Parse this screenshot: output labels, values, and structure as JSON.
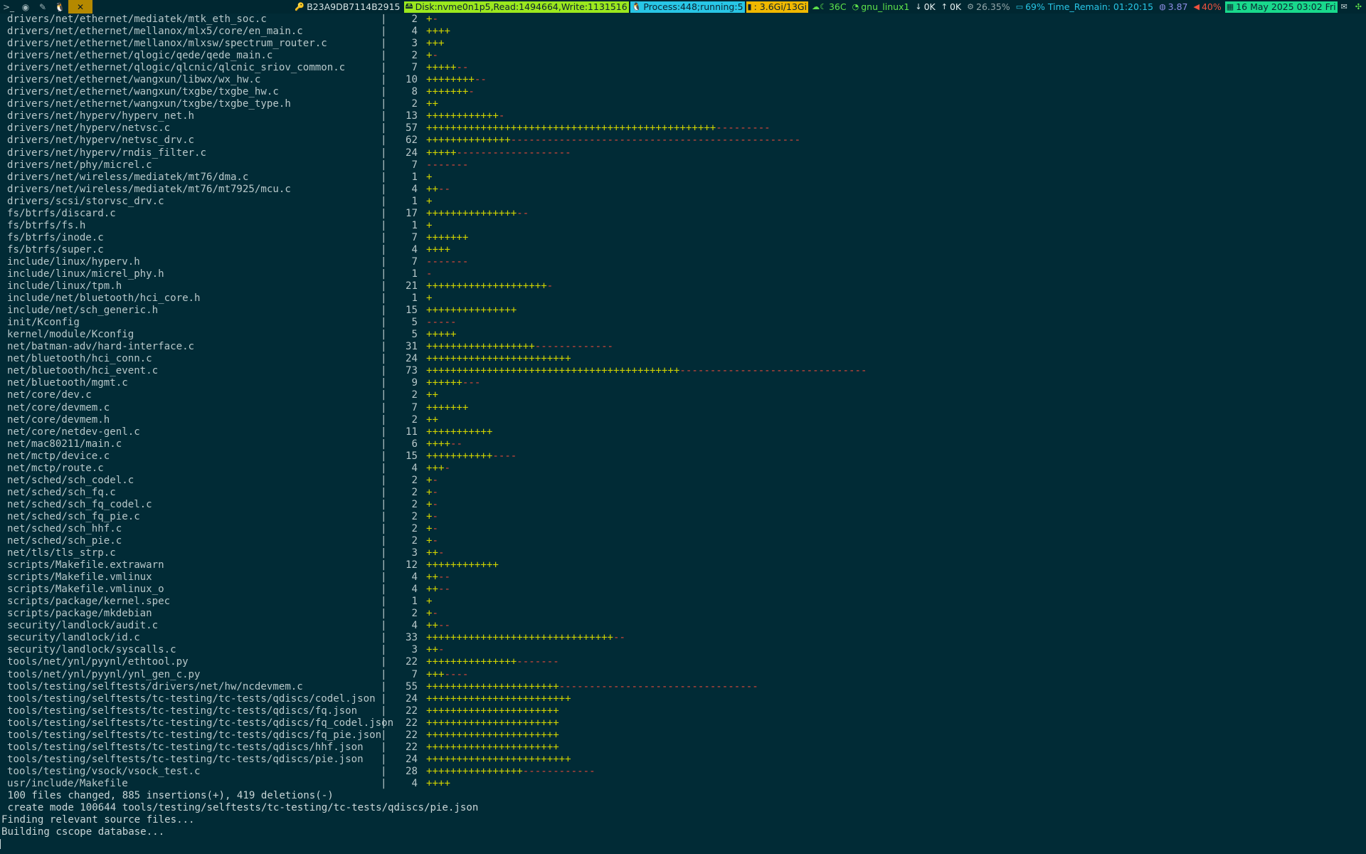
{
  "topbar": {
    "workspaces": [
      {
        "icon": ">_",
        "active": false
      },
      {
        "icon": "◉",
        "active": false
      },
      {
        "icon": "✎",
        "active": false
      },
      {
        "icon": "🐧",
        "active": false
      },
      {
        "icon": "✕",
        "active": true
      }
    ],
    "host": "B23A9DB7114B2915",
    "disk": "Disk:nvme0n1p5,Read:1494664,Write:1131516",
    "process": "Process:448;running:5",
    "memory": " : 3.6Gi/13Gi",
    "temp": "36C",
    "wifi": "gnu_linux1",
    "net_down": "0K",
    "net_up": "0K",
    "cpu": "26.35%",
    "battery": "69% Time_Remain: 01:20:15",
    "load": "3.87",
    "volume": "40%",
    "date": "16 May 2025 03:02 Fri",
    "colors": {
      "accent": "#b58900",
      "disk": "#9be81e",
      "process": "#28c6e6",
      "memory": "#f0b800",
      "date": "#19d98c",
      "plus": "#d1d300",
      "minus": "#e0483a",
      "background": "#012b36"
    }
  },
  "diffstat": [
    {
      "path": "drivers/net/ethernet/mediatek/mtk_eth_soc.c",
      "n": "2",
      "plus": "+",
      "minus": "-"
    },
    {
      "path": "drivers/net/ethernet/mellanox/mlx5/core/en_main.c",
      "n": "4",
      "plus": "++++",
      "minus": ""
    },
    {
      "path": "drivers/net/ethernet/mellanox/mlxsw/spectrum_router.c",
      "n": "3",
      "plus": "+++",
      "minus": ""
    },
    {
      "path": "drivers/net/ethernet/qlogic/qede/qede_main.c",
      "n": "2",
      "plus": "+",
      "minus": "-"
    },
    {
      "path": "drivers/net/ethernet/qlogic/qlcnic/qlcnic_sriov_common.c",
      "n": "7",
      "plus": "+++++",
      "minus": "--"
    },
    {
      "path": "drivers/net/ethernet/wangxun/libwx/wx_hw.c",
      "n": "10",
      "plus": "++++++++",
      "minus": "--"
    },
    {
      "path": "drivers/net/ethernet/wangxun/txgbe/txgbe_hw.c",
      "n": "8",
      "plus": "+++++++",
      "minus": "-"
    },
    {
      "path": "drivers/net/ethernet/wangxun/txgbe/txgbe_type.h",
      "n": "2",
      "plus": "++",
      "minus": ""
    },
    {
      "path": "drivers/net/hyperv/hyperv_net.h",
      "n": "13",
      "plus": "++++++++++++",
      "minus": "-"
    },
    {
      "path": "drivers/net/hyperv/netvsc.c",
      "n": "57",
      "plus": "++++++++++++++++++++++++++++++++++++++++++++++++",
      "minus": "---------"
    },
    {
      "path": "drivers/net/hyperv/netvsc_drv.c",
      "n": "62",
      "plus": "++++++++++++++",
      "minus": "------------------------------------------------"
    },
    {
      "path": "drivers/net/hyperv/rndis_filter.c",
      "n": "24",
      "plus": "+++++",
      "minus": "-------------------"
    },
    {
      "path": "drivers/net/phy/micrel.c",
      "n": "7",
      "plus": "",
      "minus": "-------"
    },
    {
      "path": "drivers/net/wireless/mediatek/mt76/dma.c",
      "n": "1",
      "plus": "+",
      "minus": ""
    },
    {
      "path": "drivers/net/wireless/mediatek/mt76/mt7925/mcu.c",
      "n": "4",
      "plus": "++",
      "minus": "--"
    },
    {
      "path": "drivers/scsi/storvsc_drv.c",
      "n": "1",
      "plus": "+",
      "minus": ""
    },
    {
      "path": "fs/btrfs/discard.c",
      "n": "17",
      "plus": "+++++++++++++++",
      "minus": "--"
    },
    {
      "path": "fs/btrfs/fs.h",
      "n": "1",
      "plus": "+",
      "minus": ""
    },
    {
      "path": "fs/btrfs/inode.c",
      "n": "7",
      "plus": "+++++++",
      "minus": ""
    },
    {
      "path": "fs/btrfs/super.c",
      "n": "4",
      "plus": "++++",
      "minus": ""
    },
    {
      "path": "include/linux/hyperv.h",
      "n": "7",
      "plus": "",
      "minus": "-------"
    },
    {
      "path": "include/linux/micrel_phy.h",
      "n": "1",
      "plus": "",
      "minus": "-"
    },
    {
      "path": "include/linux/tpm.h",
      "n": "21",
      "plus": "++++++++++++++++++++",
      "minus": "-"
    },
    {
      "path": "include/net/bluetooth/hci_core.h",
      "n": "1",
      "plus": "+",
      "minus": ""
    },
    {
      "path": "include/net/sch_generic.h",
      "n": "15",
      "plus": "+++++++++++++++",
      "minus": ""
    },
    {
      "path": "init/Kconfig",
      "n": "5",
      "plus": "",
      "minus": "-----"
    },
    {
      "path": "kernel/module/Kconfig",
      "n": "5",
      "plus": "+++++",
      "minus": ""
    },
    {
      "path": "net/batman-adv/hard-interface.c",
      "n": "31",
      "plus": "++++++++++++++++++",
      "minus": "-------------"
    },
    {
      "path": "net/bluetooth/hci_conn.c",
      "n": "24",
      "plus": "++++++++++++++++++++++++",
      "minus": ""
    },
    {
      "path": "net/bluetooth/hci_event.c",
      "n": "73",
      "plus": "++++++++++++++++++++++++++++++++++++++++++",
      "minus": "-------------------------------"
    },
    {
      "path": "net/bluetooth/mgmt.c",
      "n": "9",
      "plus": "++++++",
      "minus": "---"
    },
    {
      "path": "net/core/dev.c",
      "n": "2",
      "plus": "++",
      "minus": ""
    },
    {
      "path": "net/core/devmem.c",
      "n": "7",
      "plus": "+++++++",
      "minus": ""
    },
    {
      "path": "net/core/devmem.h",
      "n": "2",
      "plus": "++",
      "minus": ""
    },
    {
      "path": "net/core/netdev-genl.c",
      "n": "11",
      "plus": "+++++++++++",
      "minus": ""
    },
    {
      "path": "net/mac80211/main.c",
      "n": "6",
      "plus": "++++",
      "minus": "--"
    },
    {
      "path": "net/mctp/device.c",
      "n": "15",
      "plus": "+++++++++++",
      "minus": "----"
    },
    {
      "path": "net/mctp/route.c",
      "n": "4",
      "plus": "+++",
      "minus": "-"
    },
    {
      "path": "net/sched/sch_codel.c",
      "n": "2",
      "plus": "+",
      "minus": "-"
    },
    {
      "path": "net/sched/sch_fq.c",
      "n": "2",
      "plus": "+",
      "minus": "-"
    },
    {
      "path": "net/sched/sch_fq_codel.c",
      "n": "2",
      "plus": "+",
      "minus": "-"
    },
    {
      "path": "net/sched/sch_fq_pie.c",
      "n": "2",
      "plus": "+",
      "minus": "-"
    },
    {
      "path": "net/sched/sch_hhf.c",
      "n": "2",
      "plus": "+",
      "minus": "-"
    },
    {
      "path": "net/sched/sch_pie.c",
      "n": "2",
      "plus": "+",
      "minus": "-"
    },
    {
      "path": "net/tls/tls_strp.c",
      "n": "3",
      "plus": "++",
      "minus": "-"
    },
    {
      "path": "scripts/Makefile.extrawarn",
      "n": "12",
      "plus": "++++++++++++",
      "minus": ""
    },
    {
      "path": "scripts/Makefile.vmlinux",
      "n": "4",
      "plus": "++",
      "minus": "--"
    },
    {
      "path": "scripts/Makefile.vmlinux_o",
      "n": "4",
      "plus": "++",
      "minus": "--"
    },
    {
      "path": "scripts/package/kernel.spec",
      "n": "1",
      "plus": "+",
      "minus": ""
    },
    {
      "path": "scripts/package/mkdebian",
      "n": "2",
      "plus": "+",
      "minus": "-"
    },
    {
      "path": "security/landlock/audit.c",
      "n": "4",
      "plus": "++",
      "minus": "--"
    },
    {
      "path": "security/landlock/id.c",
      "n": "33",
      "plus": "+++++++++++++++++++++++++++++++",
      "minus": "--"
    },
    {
      "path": "security/landlock/syscalls.c",
      "n": "3",
      "plus": "++",
      "minus": "-"
    },
    {
      "path": "tools/net/ynl/pyynl/ethtool.py",
      "n": "22",
      "plus": "+++++++++++++++",
      "minus": "-------"
    },
    {
      "path": "tools/net/ynl/pyynl/ynl_gen_c.py",
      "n": "7",
      "plus": "+++",
      "minus": "----"
    },
    {
      "path": "tools/testing/selftests/drivers/net/hw/ncdevmem.c",
      "n": "55",
      "plus": "++++++++++++++++++++++",
      "minus": "---------------------------------"
    },
    {
      "path": "tools/testing/selftests/tc-testing/tc-tests/qdiscs/codel.json",
      "n": "24",
      "plus": "++++++++++++++++++++++++",
      "minus": ""
    },
    {
      "path": "tools/testing/selftests/tc-testing/tc-tests/qdiscs/fq.json",
      "n": "22",
      "plus": "++++++++++++++++++++++",
      "minus": ""
    },
    {
      "path": "tools/testing/selftests/tc-testing/tc-tests/qdiscs/fq_codel.json",
      "n": "22",
      "plus": "++++++++++++++++++++++",
      "minus": ""
    },
    {
      "path": "tools/testing/selftests/tc-testing/tc-tests/qdiscs/fq_pie.json",
      "n": "22",
      "plus": "++++++++++++++++++++++",
      "minus": ""
    },
    {
      "path": "tools/testing/selftests/tc-testing/tc-tests/qdiscs/hhf.json",
      "n": "22",
      "plus": "++++++++++++++++++++++",
      "minus": ""
    },
    {
      "path": "tools/testing/selftests/tc-testing/tc-tests/qdiscs/pie.json",
      "n": "24",
      "plus": "++++++++++++++++++++++++",
      "minus": ""
    },
    {
      "path": "tools/testing/vsock/vsock_test.c",
      "n": "28",
      "plus": "++++++++++++++++",
      "minus": "------------"
    },
    {
      "path": "usr/include/Makefile",
      "n": "4",
      "plus": "++++",
      "minus": ""
    }
  ],
  "summary": " 100 files changed, 885 insertions(+), 419 deletions(-)",
  "output_lines": [
    " create mode 100644 tools/testing/selftests/tc-testing/tc-tests/qdiscs/pie.json",
    "Finding relevant source files...",
    "Building cscope database..."
  ]
}
